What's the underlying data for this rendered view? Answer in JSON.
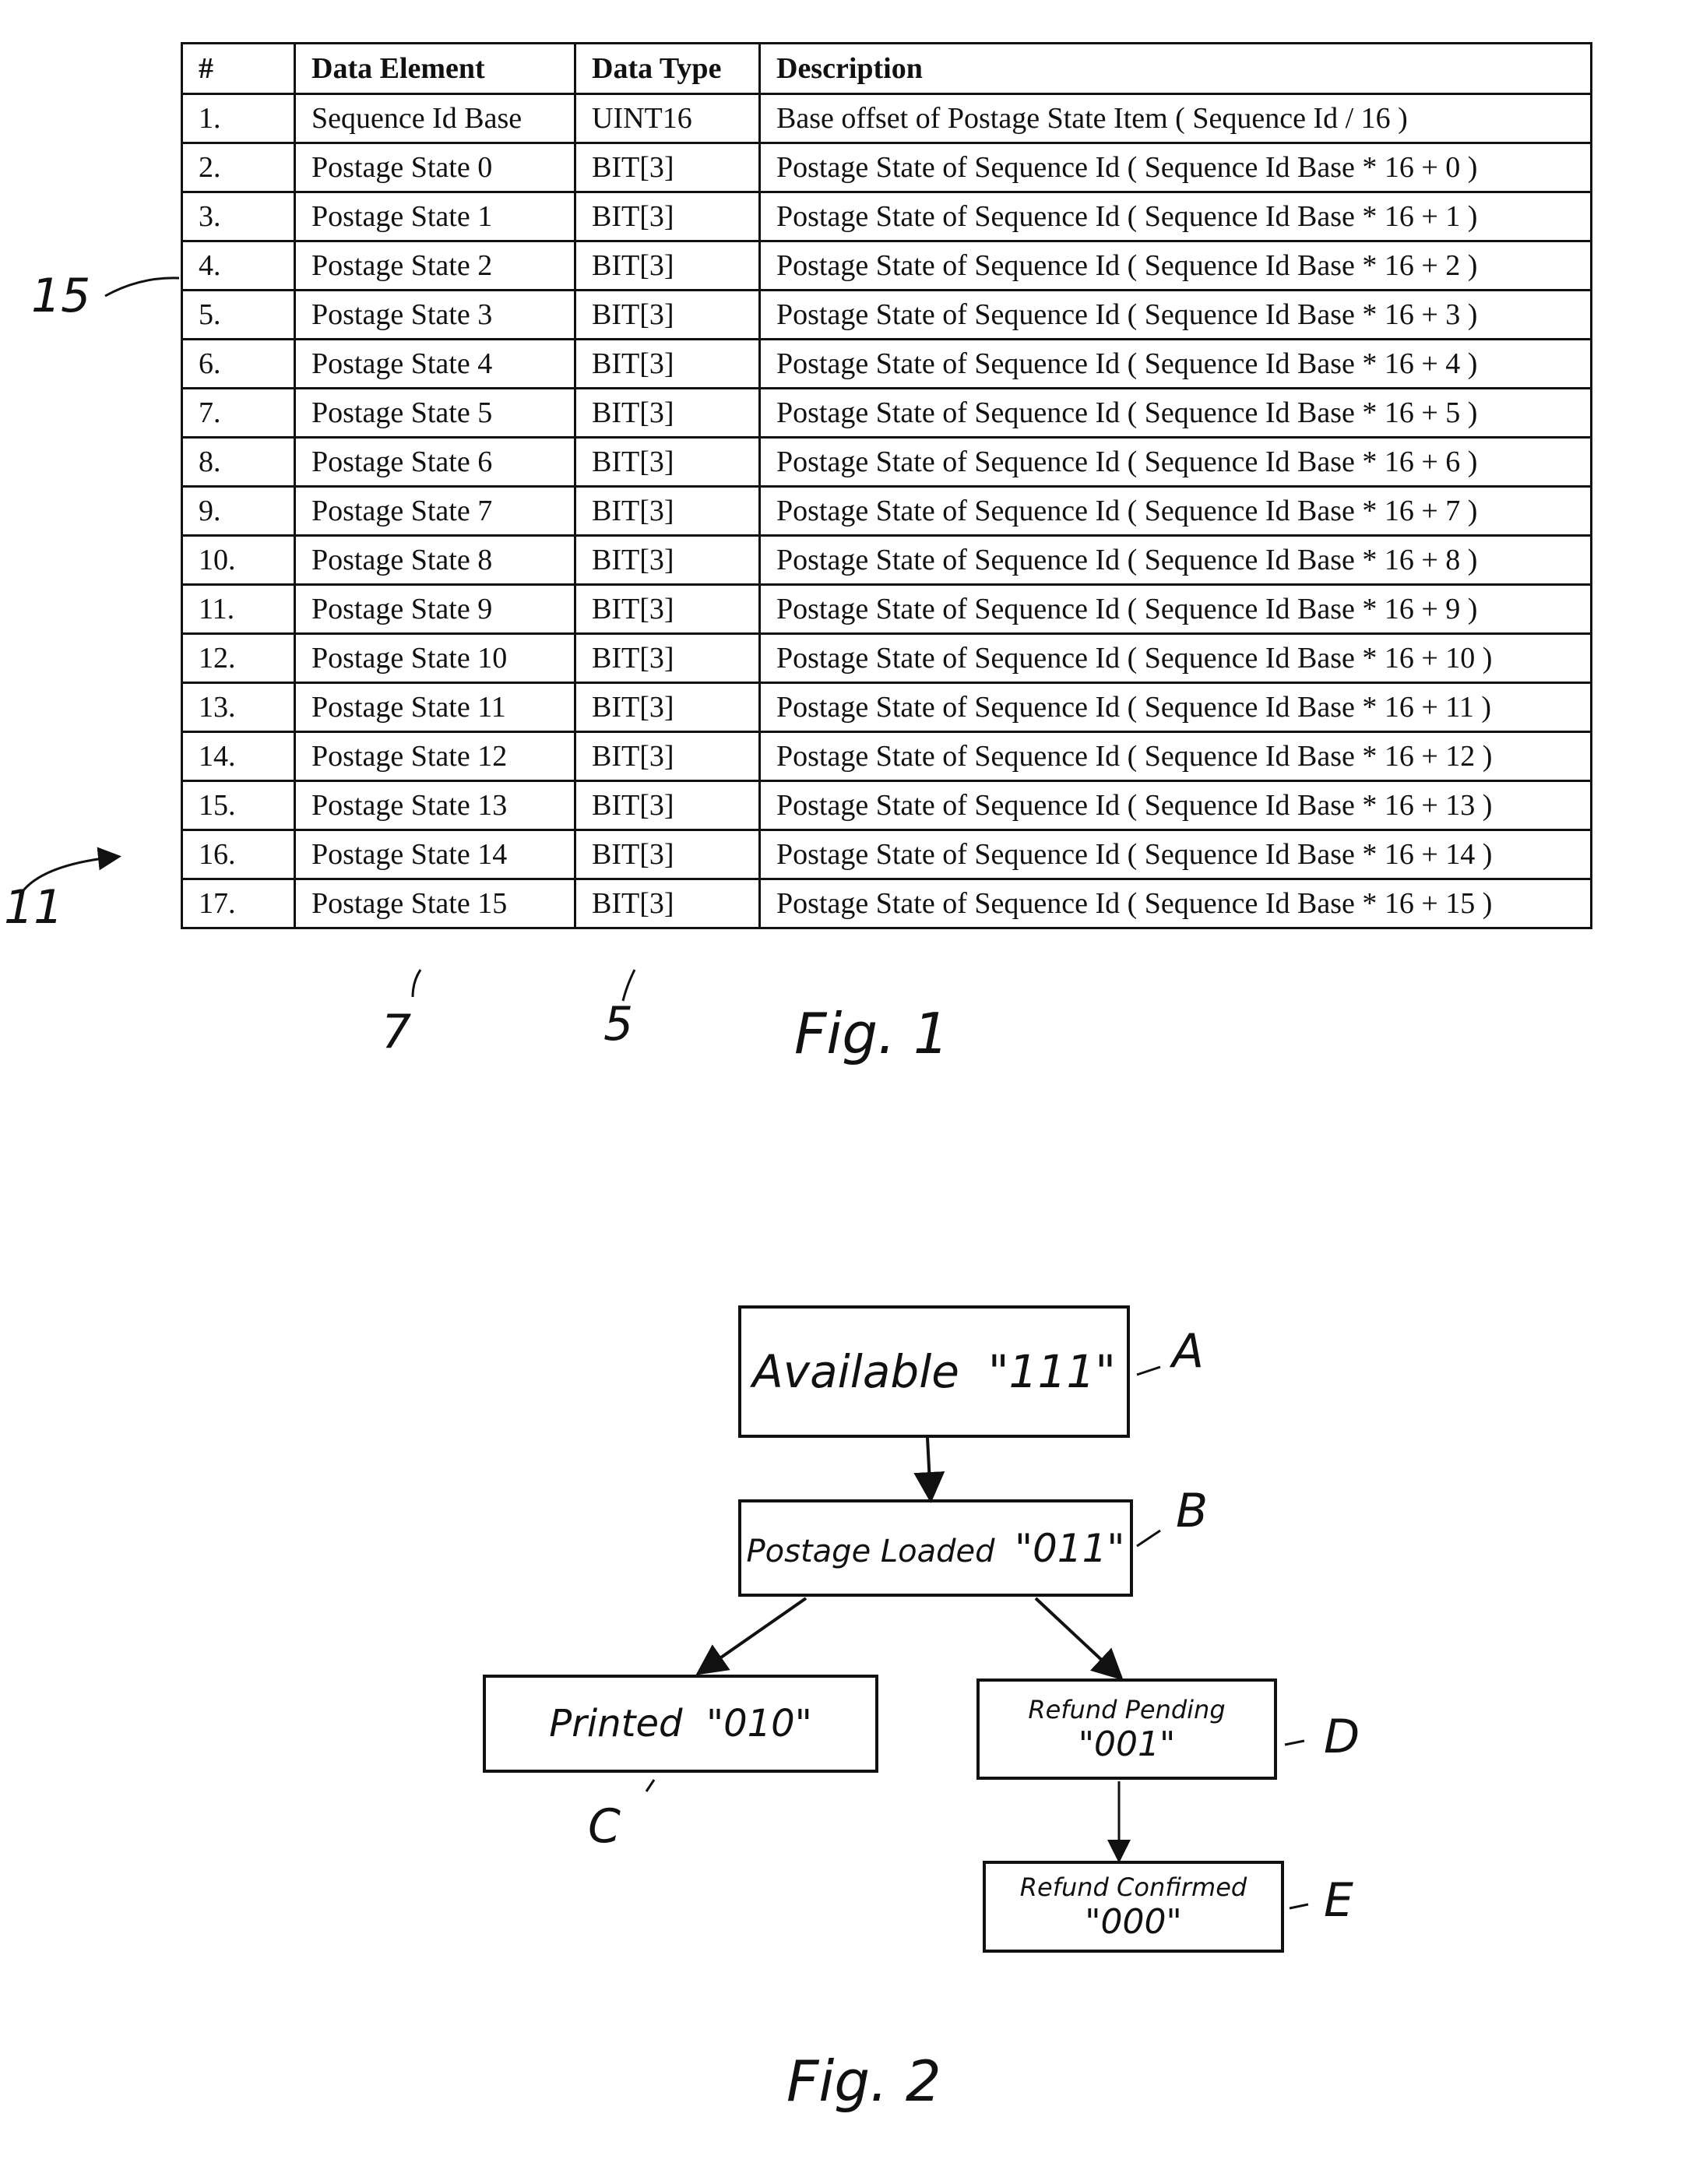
{
  "fig1": {
    "label": "Fig. 1",
    "headers": [
      "#",
      "Data Element",
      "Data Type",
      "Description"
    ],
    "rows": [
      [
        "1.",
        "Sequence Id Base",
        "UINT16",
        "Base offset of Postage State Item ( Sequence Id / 16 )"
      ],
      [
        "2.",
        "Postage State 0",
        "BIT[3]",
        "Postage State of Sequence Id ( Sequence Id Base * 16 + 0 )"
      ],
      [
        "3.",
        "Postage State 1",
        "BIT[3]",
        "Postage State of Sequence Id ( Sequence Id Base * 16 + 1 )"
      ],
      [
        "4.",
        "Postage State 2",
        "BIT[3]",
        "Postage State of Sequence Id ( Sequence Id Base * 16 + 2 )"
      ],
      [
        "5.",
        "Postage State 3",
        "BIT[3]",
        "Postage State of Sequence Id ( Sequence Id Base * 16 + 3 )"
      ],
      [
        "6.",
        "Postage State 4",
        "BIT[3]",
        "Postage State of Sequence Id ( Sequence Id Base * 16 + 4 )"
      ],
      [
        "7.",
        "Postage State 5",
        "BIT[3]",
        "Postage State of Sequence Id ( Sequence Id Base * 16 + 5 )"
      ],
      [
        "8.",
        "Postage State 6",
        "BIT[3]",
        "Postage State of Sequence Id ( Sequence Id Base * 16 + 6 )"
      ],
      [
        "9.",
        "Postage State 7",
        "BIT[3]",
        "Postage State of Sequence Id ( Sequence Id Base * 16 + 7 )"
      ],
      [
        "10.",
        "Postage State 8",
        "BIT[3]",
        "Postage State of Sequence Id ( Sequence Id Base * 16 + 8 )"
      ],
      [
        "11.",
        "Postage State 9",
        "BIT[3]",
        "Postage State of Sequence Id ( Sequence Id Base * 16 + 9 )"
      ],
      [
        "12.",
        "Postage State 10",
        "BIT[3]",
        "Postage State of Sequence Id ( Sequence Id Base * 16 + 10 )"
      ],
      [
        "13.",
        "Postage State 11",
        "BIT[3]",
        "Postage State of Sequence Id ( Sequence Id Base * 16 + 11 )"
      ],
      [
        "14.",
        "Postage State 12",
        "BIT[3]",
        "Postage State of Sequence Id ( Sequence Id Base * 16 + 12 )"
      ],
      [
        "15.",
        "Postage State 13",
        "BIT[3]",
        "Postage State of Sequence Id ( Sequence Id Base * 16 + 13 )"
      ],
      [
        "16.",
        "Postage State 14",
        "BIT[3]",
        "Postage State of Sequence Id ( Sequence Id Base * 16 + 14 )"
      ],
      [
        "17.",
        "Postage State 15",
        "BIT[3]",
        "Postage State of Sequence Id ( Sequence Id Base * 16 + 15 )"
      ]
    ],
    "refs": {
      "row_ref": "15",
      "table_ref": "11",
      "element_col_ref": "7",
      "type_col_ref": "5"
    }
  },
  "fig2": {
    "label": "Fig. 2",
    "states": [
      {
        "id": "A",
        "name": "Available",
        "code": "\"111\""
      },
      {
        "id": "B",
        "name": "Postage Loaded",
        "code": "\"011\""
      },
      {
        "id": "C",
        "name": "Printed",
        "code": "\"010\""
      },
      {
        "id": "D",
        "name": "Refund Pending",
        "code": "\"001\""
      },
      {
        "id": "E",
        "name": "Refund Confirmed",
        "code": "\"000\""
      }
    ],
    "transitions": [
      [
        "A",
        "B"
      ],
      [
        "B",
        "C"
      ],
      [
        "B",
        "D"
      ],
      [
        "D",
        "E"
      ]
    ]
  }
}
